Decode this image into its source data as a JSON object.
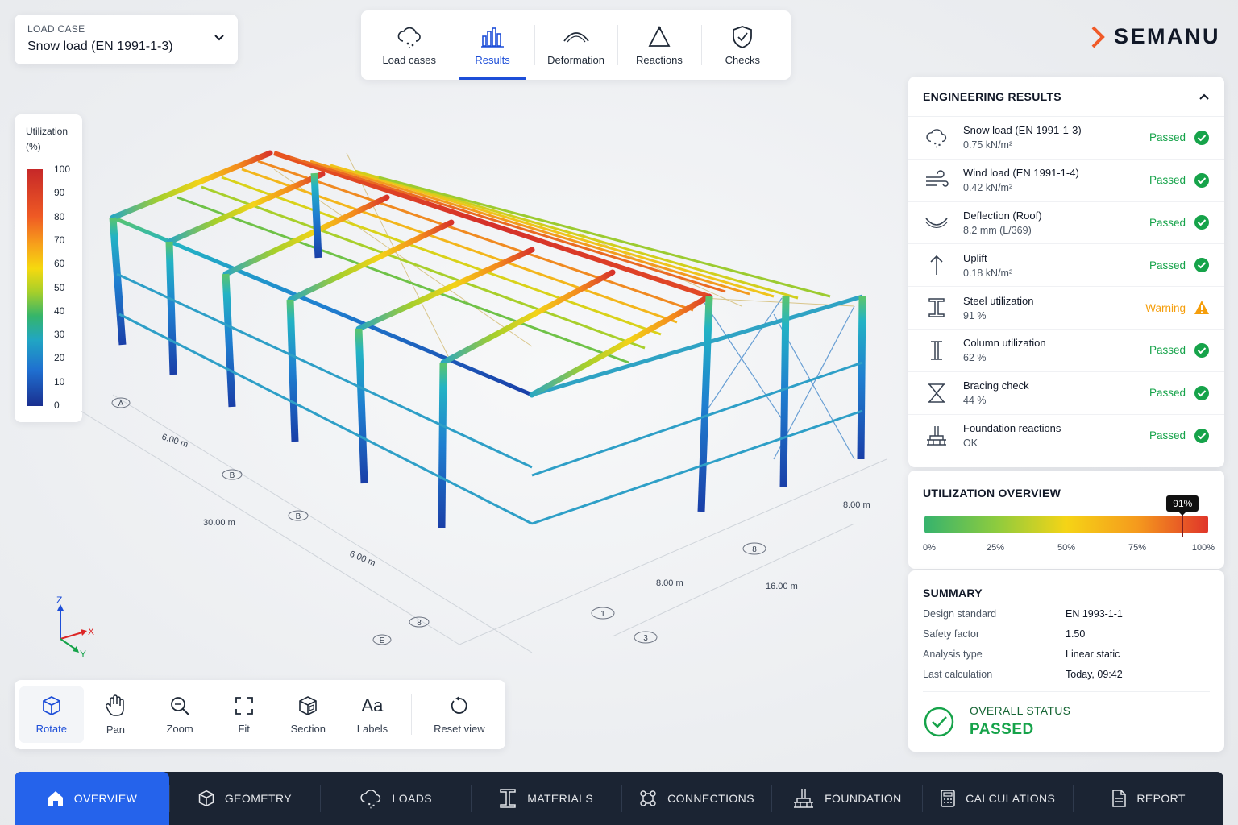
{
  "load_case": {
    "label": "LOAD CASE",
    "value": "Snow load (EN 1991-1-3)"
  },
  "top_tabs": [
    {
      "label": "Load cases",
      "icon": "snow-cloud-icon"
    },
    {
      "label": "Results",
      "icon": "bar-chart-icon",
      "active": true
    },
    {
      "label": "Deformation",
      "icon": "arc-icon"
    },
    {
      "label": "Reactions",
      "icon": "triangle-support-icon"
    },
    {
      "label": "Checks",
      "icon": "shield-check-icon"
    }
  ],
  "brand": {
    "name": "SEMANU",
    "accent": "#f05a28"
  },
  "legend": {
    "title_line1": "Utilization",
    "title_line2": "(%)",
    "ticks": [
      "100",
      "90",
      "80",
      "70",
      "60",
      "50",
      "40",
      "30",
      "20",
      "10",
      "0"
    ]
  },
  "dimensions": {
    "d1": "6.00 m",
    "d2": "30.00 m",
    "d3": "6.00 m",
    "d4": "8.00 m",
    "d5": "16.00 m",
    "d6": "8.00 m"
  },
  "grid_markers": {
    "a": "A",
    "b1": "B",
    "b2": "B",
    "b3": "8",
    "e": "E",
    "c": "8",
    "g1": "1",
    "g3": "3",
    "g8": "8"
  },
  "axes": {
    "z": "Z",
    "x": "X",
    "y": "Y"
  },
  "view_tools": [
    {
      "label": "Rotate",
      "icon": "cube-icon",
      "active": true
    },
    {
      "label": "Pan",
      "icon": "hand-icon"
    },
    {
      "label": "Zoom",
      "icon": "zoom-icon"
    },
    {
      "label": "Fit",
      "icon": "fit-icon"
    },
    {
      "label": "Section",
      "icon": "section-cube-icon"
    },
    {
      "label": "Labels",
      "icon": "labels-icon",
      "glyph": "Aa"
    },
    {
      "label": "Reset view",
      "icon": "reset-icon"
    }
  ],
  "engineering_results": {
    "title": "ENGINEERING RESULTS",
    "rows": [
      {
        "name": "Snow load (EN 1991-1-3)",
        "value": "0.75 kN/m²",
        "status": "Passed",
        "icon": "snow-cloud-icon"
      },
      {
        "name": "Wind load (EN 1991-1-4)",
        "value": "0.42 kN/m²",
        "status": "Passed",
        "icon": "wind-icon"
      },
      {
        "name": "Deflection (Roof)",
        "value": "8.2 mm (L/369)",
        "status": "Passed",
        "icon": "deflection-icon"
      },
      {
        "name": "Uplift",
        "value": "0.18 kN/m²",
        "status": "Passed",
        "icon": "arrow-up-icon"
      },
      {
        "name": "Steel utilization",
        "value": "91 %",
        "status": "Warning",
        "icon": "i-beam-icon"
      },
      {
        "name": "Column utilization",
        "value": "62 %",
        "status": "Passed",
        "icon": "column-icon"
      },
      {
        "name": "Bracing check",
        "value": "44 %",
        "status": "Passed",
        "icon": "bracing-icon"
      },
      {
        "name": "Foundation reactions",
        "value": "OK",
        "status": "Passed",
        "icon": "foundation-icon"
      }
    ]
  },
  "utilization_overview": {
    "title": "UTILIZATION OVERVIEW",
    "value_label": "91%",
    "value": 0.91,
    "ticks": [
      "0%",
      "25%",
      "50%",
      "75%",
      "100%"
    ]
  },
  "summary": {
    "title": "SUMMARY",
    "rows": [
      {
        "key": "Design standard",
        "value": "EN 1993-1-1"
      },
      {
        "key": "Safety factor",
        "value": "1.50"
      },
      {
        "key": "Analysis type",
        "value": "Linear static"
      },
      {
        "key": "Last calculation",
        "value": "Today, 09:42"
      }
    ],
    "overall_title": "OVERALL STATUS",
    "overall_value": "PASSED"
  },
  "bottom_nav": [
    {
      "label": "OVERVIEW",
      "icon": "home-icon",
      "active": true
    },
    {
      "label": "GEOMETRY",
      "icon": "cube-icon"
    },
    {
      "label": "LOADS",
      "icon": "snow-cloud-icon"
    },
    {
      "label": "MATERIALS",
      "icon": "i-beam-icon"
    },
    {
      "label": "CONNECTIONS",
      "icon": "connections-icon"
    },
    {
      "label": "FOUNDATION",
      "icon": "foundation-icon"
    },
    {
      "label": "CALCULATIONS",
      "icon": "calculator-icon"
    },
    {
      "label": "REPORT",
      "icon": "report-icon"
    }
  ],
  "colors": {
    "accent": "#1d4ed8",
    "passed": "#16a34a",
    "warning": "#f59e0b",
    "nav_bg": "#1b2433"
  }
}
